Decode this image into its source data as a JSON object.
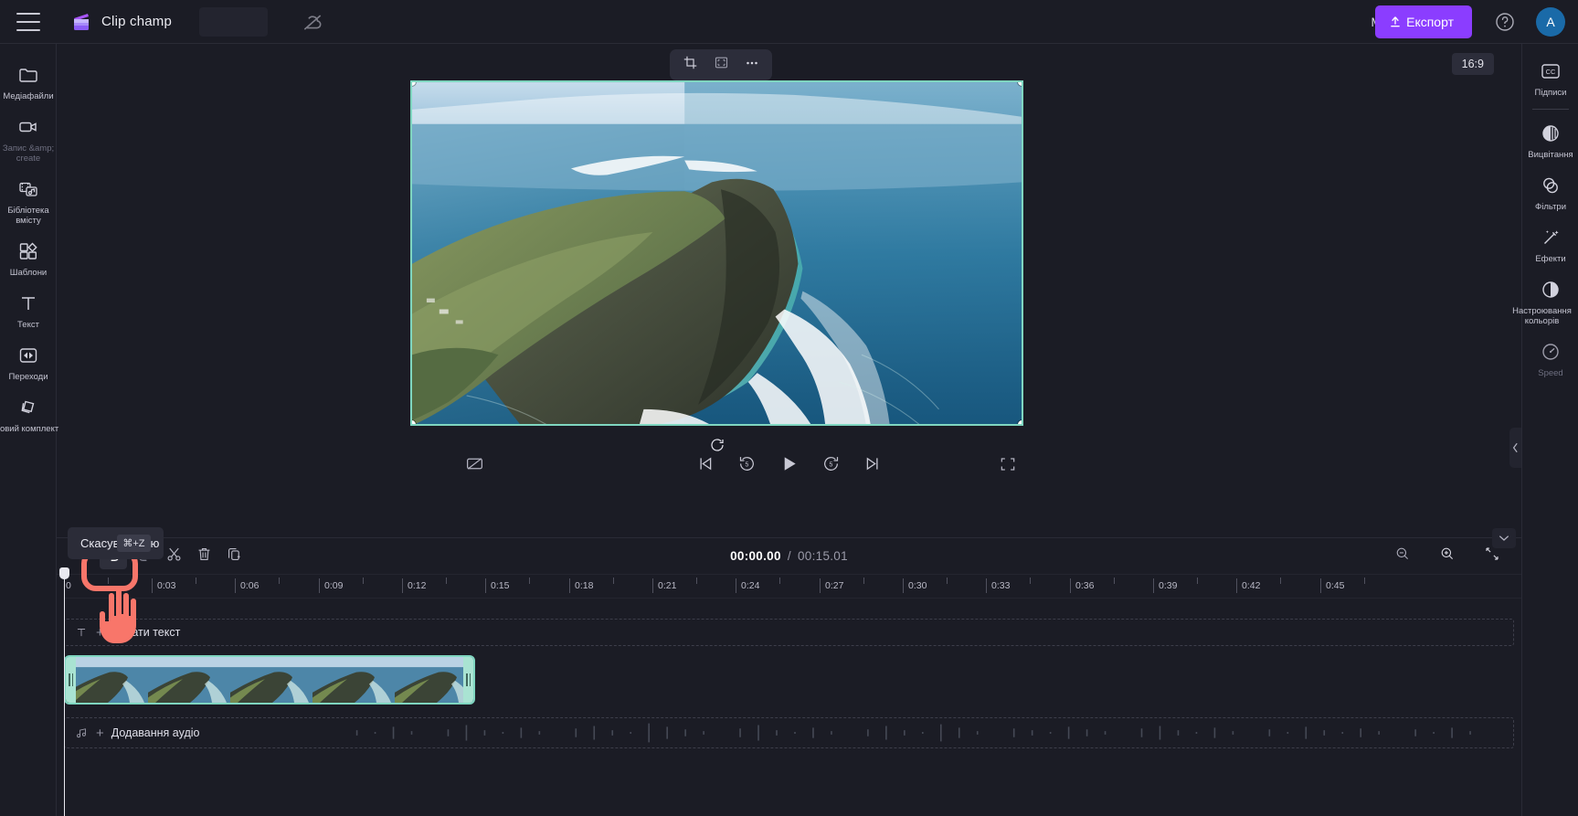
{
  "app": {
    "brand": "Clip champ",
    "project_title": "Моє відео",
    "export_label": "Експорт",
    "avatar_initial": "A",
    "menu_icon": "hamburger-icon",
    "cloud_icon": "cloud-off-icon",
    "help_icon": "help-circle-icon"
  },
  "left_rail": [
    {
      "label": "Медіафайли",
      "icon": "folder-icon",
      "dim": false
    },
    {
      "label": "Запис &amp; create",
      "icon": "video-camera-icon",
      "dim": true
    },
    {
      "label": "Бібліотека вмісту",
      "icon": "content-library-icon",
      "dim": false
    },
    {
      "label": "Шаблони",
      "icon": "templates-icon",
      "dim": false
    },
    {
      "label": "Текст",
      "icon": "text-icon",
      "dim": false
    },
    {
      "label": "Переходи",
      "icon": "transitions-icon",
      "dim": false
    },
    {
      "label": "Фірмовий комплект",
      "icon": "brand-kit-icon",
      "dim": false
    }
  ],
  "right_rail": [
    {
      "label": "Підписи",
      "icon": "closed-captions-icon",
      "dim": false
    },
    {
      "label": "Вицвітання",
      "icon": "fade-icon",
      "dim": false
    },
    {
      "label": "Фільтри",
      "icon": "filters-icon",
      "dim": false
    },
    {
      "label": "Ефекти",
      "icon": "effects-wand-icon",
      "dim": false
    },
    {
      "label": "Настроювання кольорів",
      "icon": "color-adjust-icon",
      "dim": false
    },
    {
      "label": "Speed",
      "icon": "speed-gauge-icon",
      "dim": true
    }
  ],
  "canvas": {
    "aspect_ratio": "16:9",
    "toolbar": [
      {
        "name": "crop-button",
        "icon": "crop-icon"
      },
      {
        "name": "fit-button",
        "icon": "fit-frame-icon"
      },
      {
        "name": "more-options-button",
        "icon": "ellipsis-icon"
      }
    ]
  },
  "playback": {
    "captions_off": "captions-off-icon",
    "skip_start": "skip-to-start-icon",
    "rewind_5": "rewind-5-icon",
    "play": "play-icon",
    "forward_5": "forward-5-icon",
    "skip_end": "skip-to-end-icon",
    "fullscreen": "fullscreen-icon"
  },
  "timeline": {
    "current_time": "00:00.00",
    "total_time": "00:15.01",
    "separator": "/",
    "tools": [
      {
        "name": "magic-suggestion-button",
        "icon": "sparkle-icon"
      },
      {
        "name": "undo-button",
        "icon": "undo-icon"
      },
      {
        "name": "redo-button",
        "icon": "redo-icon"
      },
      {
        "name": "split-button",
        "icon": "scissors-icon"
      },
      {
        "name": "delete-button",
        "icon": "trash-icon"
      },
      {
        "name": "duplicate-button",
        "icon": "duplicate-icon"
      }
    ],
    "right_tools": [
      {
        "name": "zoom-out-button",
        "icon": "zoom-out-icon"
      },
      {
        "name": "zoom-in-button",
        "icon": "zoom-in-icon"
      },
      {
        "name": "fit-timeline-button",
        "icon": "fit-timeline-icon"
      }
    ],
    "ruler_ticks": [
      "0",
      "0:03",
      "0:06",
      "0:09",
      "0:12",
      "0:15",
      "0:18",
      "0:21",
      "0:24",
      "0:27",
      "0:30",
      "0:33",
      "0:36",
      "0:39",
      "0:42",
      "0:45"
    ],
    "text_track_label": "Додати текст",
    "audio_track_label": "Додавання аудіо"
  },
  "tooltip": {
    "text": "Скасувати дію",
    "shortcut": "⌘+Z"
  },
  "colors": {
    "accent_purple": "#8b3dff",
    "clip_border": "#7fd6c0",
    "highlight_ring": "#f8766a",
    "background": "#1b1c25",
    "avatar_blue": "#1a6aa8"
  }
}
